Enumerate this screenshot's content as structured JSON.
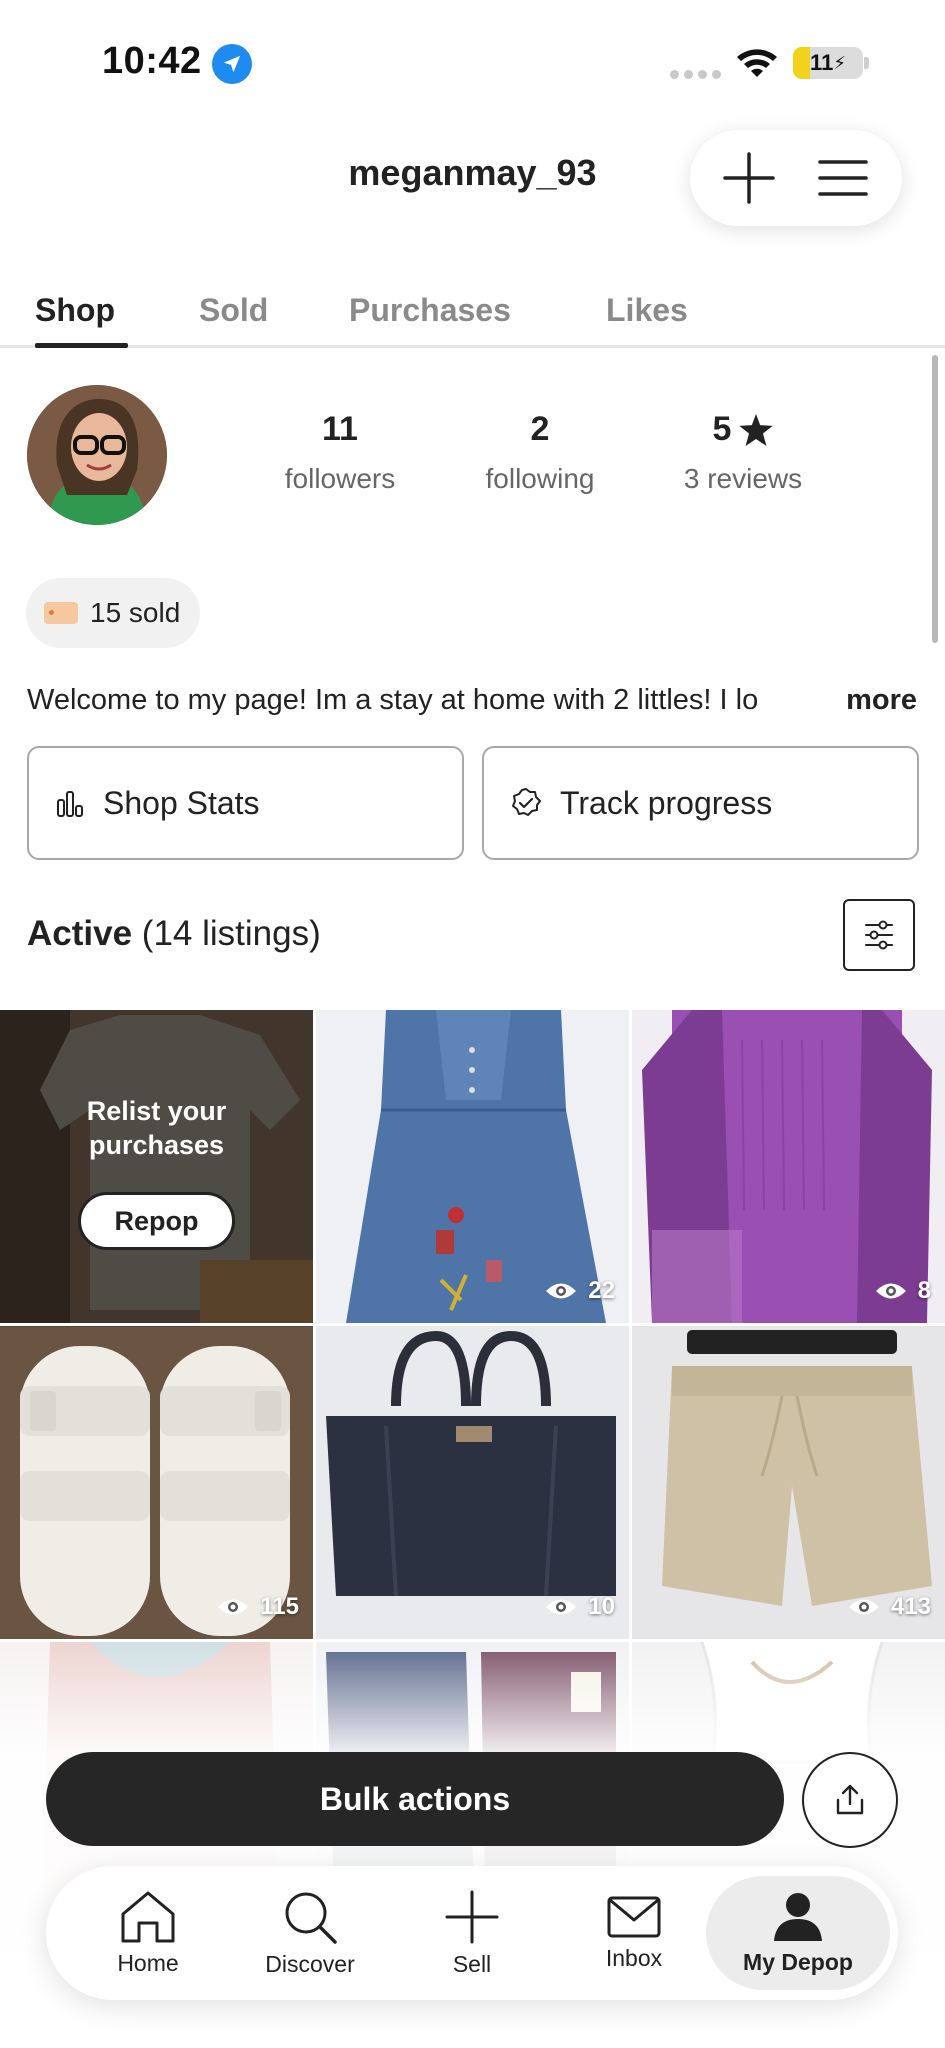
{
  "status_bar": {
    "time": "10:42",
    "battery": "11",
    "battery_level": 0.11
  },
  "header": {
    "username": "meganmay_93"
  },
  "tabs": [
    {
      "label": "Shop",
      "active": true
    },
    {
      "label": "Sold",
      "active": false
    },
    {
      "label": "Purchases",
      "active": false
    },
    {
      "label": "Likes",
      "active": false
    }
  ],
  "profile": {
    "stats": [
      {
        "value": "11",
        "label": "followers"
      },
      {
        "value": "2",
        "label": "following"
      },
      {
        "value": "5",
        "label": "3 reviews",
        "icon": "star-icon"
      }
    ],
    "sold_badge": "15 sold",
    "bio": "Welcome to my page! Im a stay at home with 2 littles! I lo",
    "bio_more": "more"
  },
  "actions": {
    "shop_stats": "Shop Stats",
    "track_progress": "Track progress"
  },
  "listings": {
    "heading_bold": "Active",
    "heading_count": "(14 listings)",
    "relist_line1": "Relist your",
    "relist_line2": "purchases",
    "repop_label": "Repop",
    "items": [
      {
        "name": "denim-dress",
        "views": "22"
      },
      {
        "name": "purple-lace-top",
        "views": "8"
      },
      {
        "name": "white-birkenstock-sandals",
        "views": "115"
      },
      {
        "name": "navy-kate-spade-handbag",
        "views": "10"
      },
      {
        "name": "tan-sweat-shorts",
        "views": "413"
      },
      {
        "name": "pink-embellished-top",
        "views": ""
      },
      {
        "name": "corduroy-pants",
        "views": ""
      },
      {
        "name": "white-ruffle-top",
        "views": ""
      }
    ]
  },
  "bulk_actions_label": "Bulk actions",
  "nav": [
    {
      "label": "Home",
      "icon": "home-icon"
    },
    {
      "label": "Discover",
      "icon": "search-icon"
    },
    {
      "label": "Sell",
      "icon": "plus-icon"
    },
    {
      "label": "Inbox",
      "icon": "mail-icon"
    },
    {
      "label": "My Depop",
      "icon": "profile-icon",
      "active": true
    }
  ],
  "colors": {
    "accent": "#262626",
    "location_blue": "#1e8bf0",
    "battery_yellow": "#f2d21b"
  }
}
